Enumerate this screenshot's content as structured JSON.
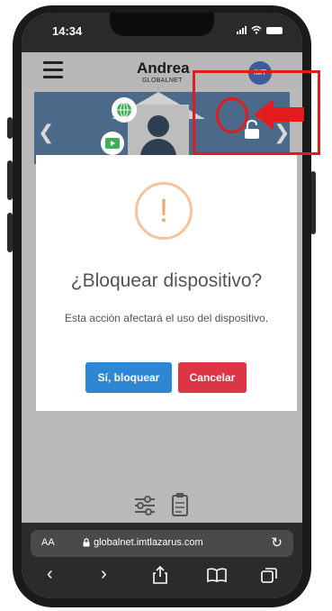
{
  "status_bar": {
    "time": "14:34"
  },
  "header": {
    "user_name": "Andrea",
    "company": "GLOBALNET",
    "logo_text": "IMT"
  },
  "banner": {
    "prev_icon": "chevron-left-icon",
    "next_icon": "chevron-right-icon"
  },
  "modal": {
    "icon": "!",
    "title": "¿Bloquear dispositivo?",
    "message": "Esta acción afectará el uso del dispositivo.",
    "confirm_label": "Sí, bloquear",
    "cancel_label": "Cancelar"
  },
  "browser": {
    "aa_label": "AA",
    "url": "globalnet.imtlazarus.com"
  },
  "colors": {
    "annotation": "#e31b1b",
    "confirm": "#2f86d2",
    "cancel": "#dc3545",
    "warning": "#f6a55e"
  }
}
